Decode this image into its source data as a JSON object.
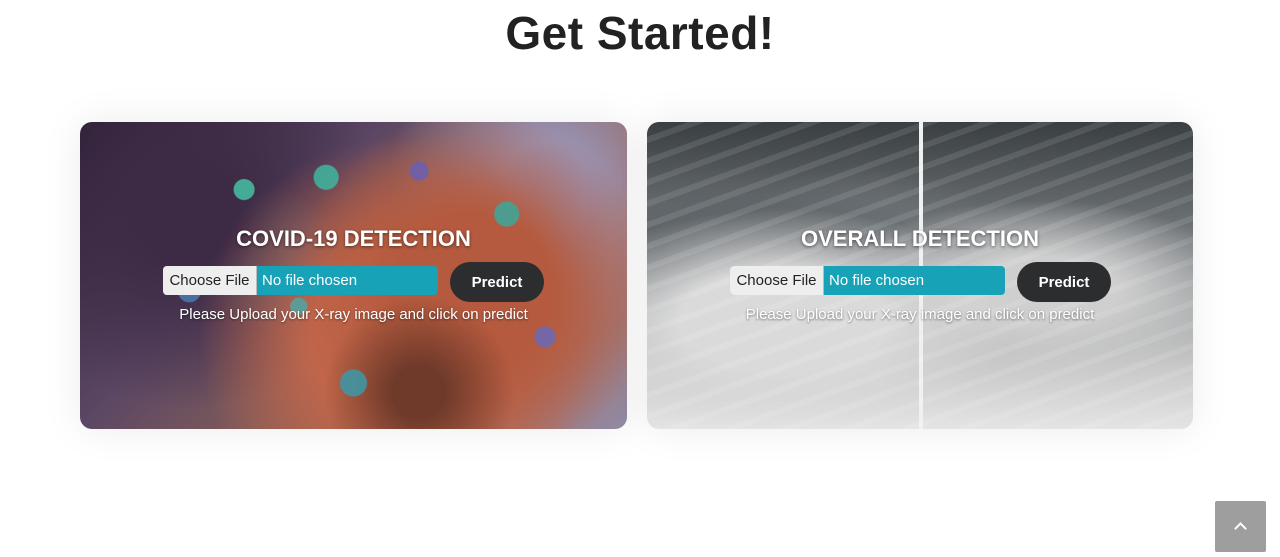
{
  "page": {
    "title": "Get Started!"
  },
  "cards": [
    {
      "title": "COVID-19 DETECTION",
      "file_button": "Choose File",
      "file_status": "No file chosen",
      "predict_label": "Predict",
      "hint": "Please Upload your X-ray image and click on predict"
    },
    {
      "title": "OVERALL DETECTION",
      "file_button": "Choose File",
      "file_status": "No file chosen",
      "predict_label": "Predict",
      "hint": "Please Upload your X-ray image and click on predict"
    }
  ],
  "colors": {
    "file_input_bg": "#17a2b8",
    "predict_bg": "#2b2d2f",
    "back_to_top_bg": "#9e9e9e"
  },
  "icons": {
    "back_to_top": "chevron-up-icon"
  }
}
